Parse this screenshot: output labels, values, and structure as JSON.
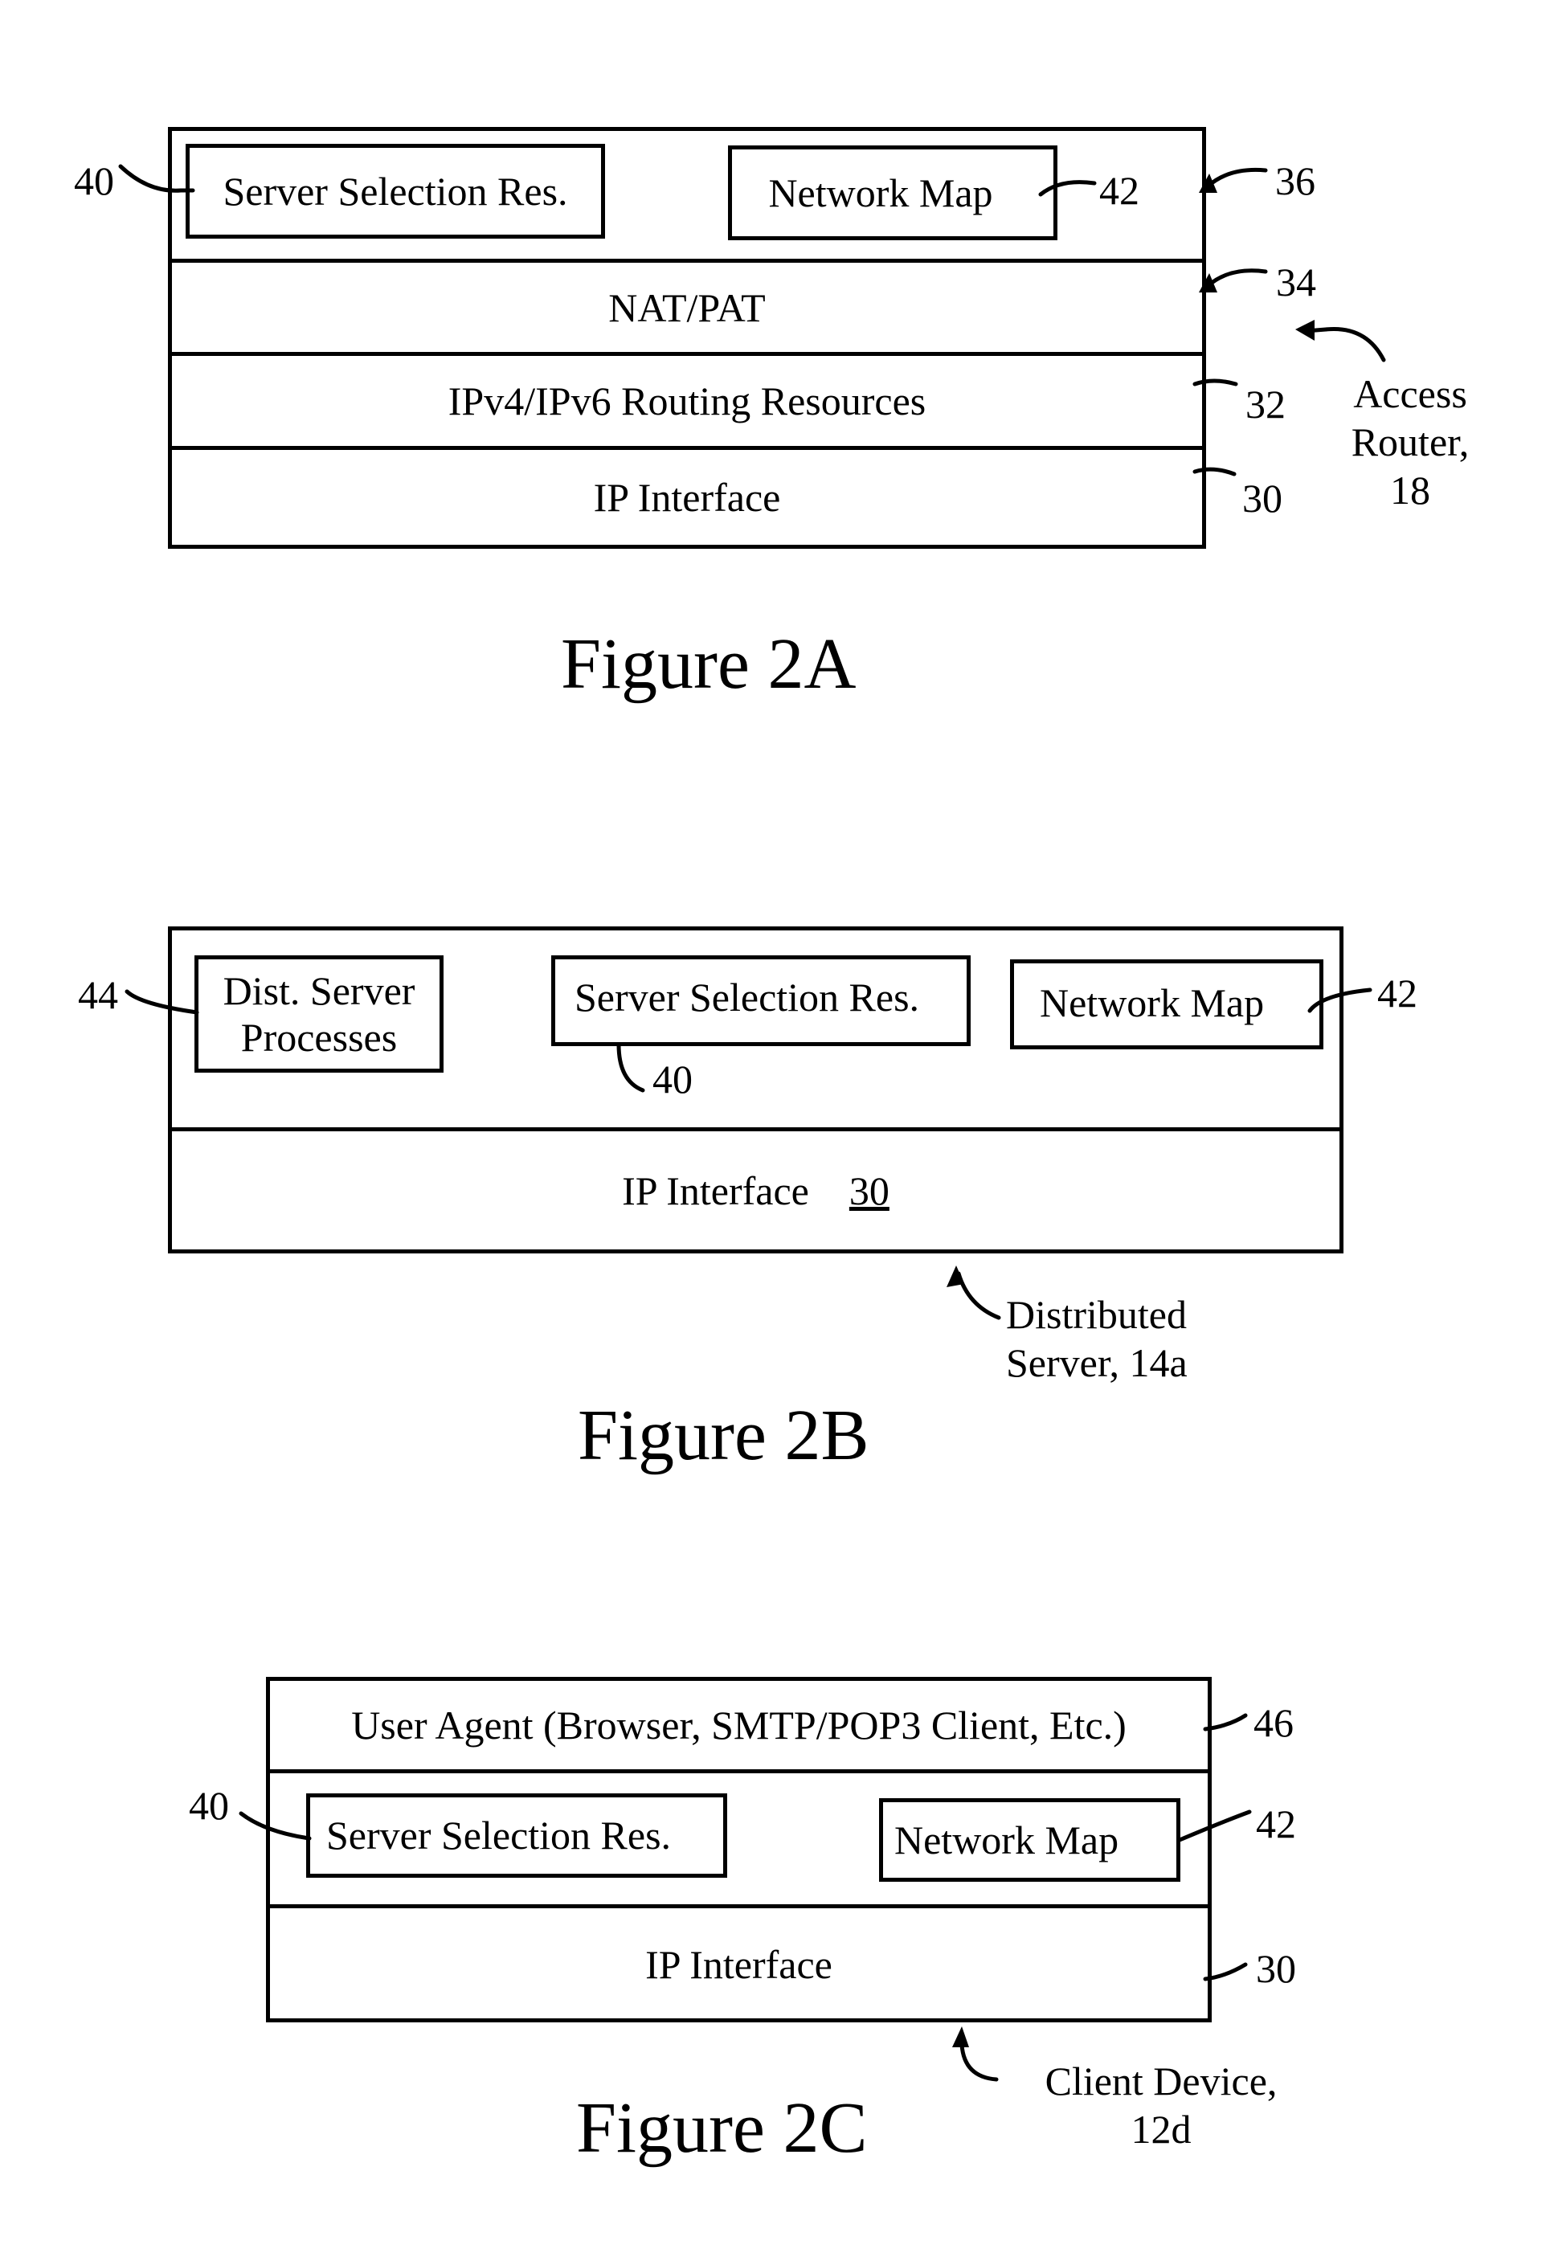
{
  "figures": [
    {
      "caption": "Figure 2A",
      "device_label": [
        "Access",
        "Router,",
        "18"
      ],
      "ref_top_layer": "36",
      "layers": [
        {
          "ref": "34",
          "label": "NAT/PAT"
        },
        {
          "ref": "32",
          "label": "IPv4/IPv6 Routing Resources"
        },
        {
          "ref": "30",
          "label": "IP Interface"
        }
      ],
      "components": [
        {
          "ref": "40",
          "label": "Server Selection Res."
        },
        {
          "ref": "42",
          "label": "Network Map"
        }
      ]
    },
    {
      "caption": "Figure 2B",
      "device_label": [
        "Distributed",
        "Server, 14a"
      ],
      "components": [
        {
          "ref": "44",
          "label": [
            "Dist. Server",
            "Processes"
          ]
        },
        {
          "ref": "40",
          "label": "Server Selection Res."
        },
        {
          "ref": "42",
          "label": "Network Map"
        }
      ],
      "layers": [
        {
          "ref": "30",
          "label": "IP Interface"
        }
      ]
    },
    {
      "caption": "Figure 2C",
      "device_label": [
        "Client Device,",
        "12d"
      ],
      "layers": [
        {
          "ref": "46",
          "label": "User Agent (Browser, SMTP/POP3 Client, Etc.)"
        },
        {
          "ref": "30",
          "label": "IP Interface"
        }
      ],
      "components": [
        {
          "ref": "40",
          "label": "Server Selection Res."
        },
        {
          "ref": "42",
          "label": "Network Map"
        }
      ]
    }
  ]
}
